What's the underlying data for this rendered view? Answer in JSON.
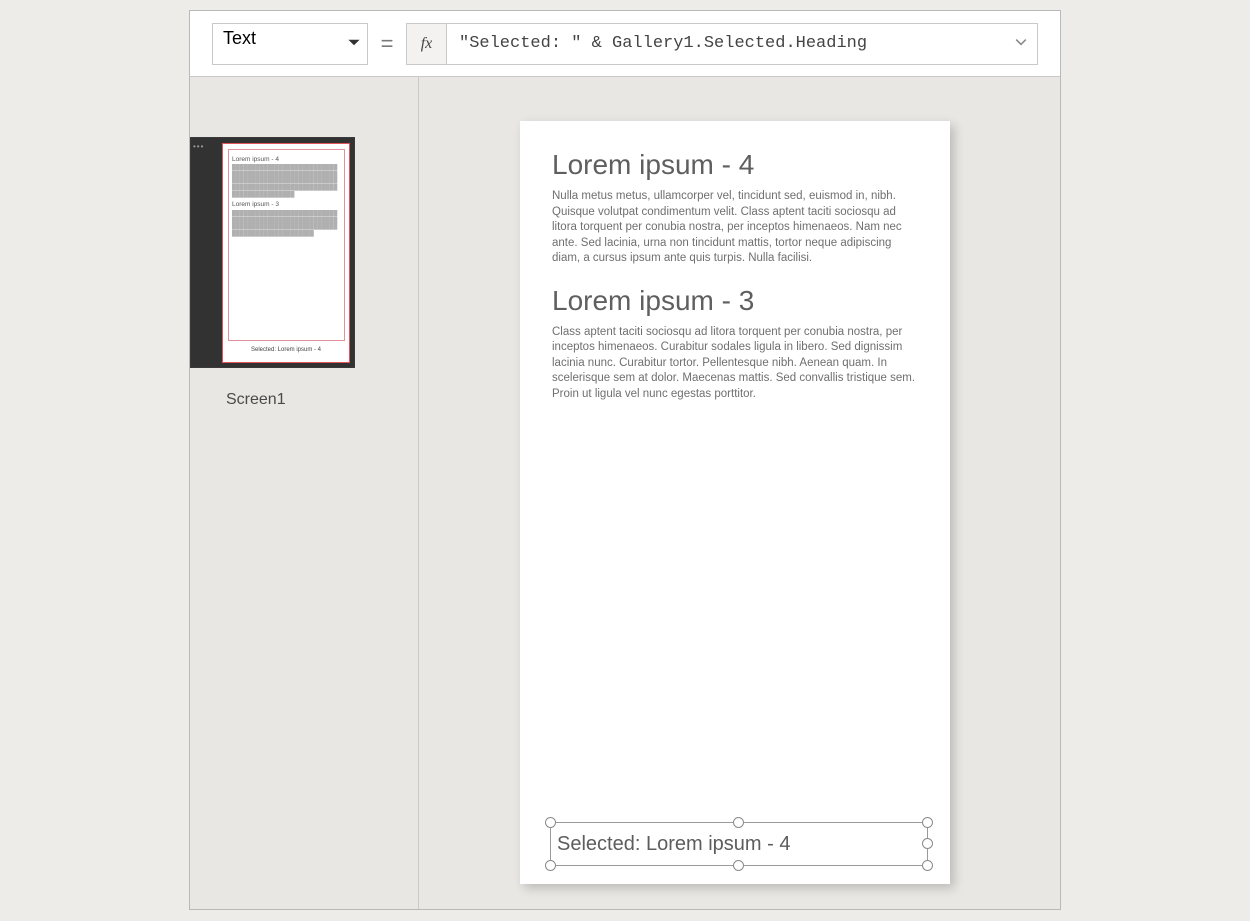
{
  "formula_bar": {
    "property": "Text",
    "equals": "=",
    "fx_label": "fx",
    "formula": "\"Selected: \" & Gallery1.Selected.Heading"
  },
  "sidebar": {
    "screen_name": "Screen1",
    "thumb": {
      "dots": "•••",
      "h1": "Lorem ipsum - 4",
      "h2": "Lorem ipsum - 3",
      "selected_mini": "Selected: Lorem ipsum - 4"
    }
  },
  "canvas": {
    "items": [
      {
        "heading": "Lorem ipsum - 4",
        "body": "Nulla metus metus, ullamcorper vel, tincidunt sed, euismod in, nibh. Quisque volutpat condimentum velit. Class aptent taciti sociosqu ad litora torquent per conubia nostra, per inceptos himenaeos. Nam nec ante. Sed lacinia, urna non tincidunt mattis, tortor neque adipiscing diam, a cursus ipsum ante quis turpis. Nulla facilisi."
      },
      {
        "heading": "Lorem ipsum - 3",
        "body": "Class aptent taciti sociosqu ad litora torquent per conubia nostra, per inceptos himenaeos. Curabitur sodales ligula in libero. Sed dignissim lacinia nunc. Curabitur tortor. Pellentesque nibh. Aenean quam. In scelerisque sem at dolor. Maecenas mattis. Sed convallis tristique sem. Proin ut ligula vel nunc egestas porttitor."
      }
    ],
    "selected_label": "Selected: Lorem ipsum - 4"
  }
}
